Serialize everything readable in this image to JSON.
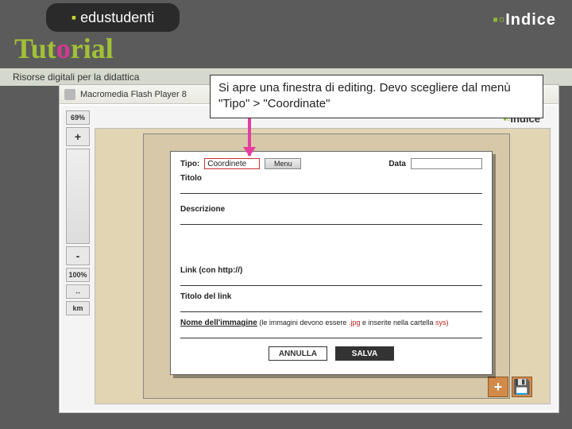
{
  "header": {
    "brand_logo": "edustudenti",
    "indice": "Indice",
    "tutorial": "Tutorial",
    "subtitle": "Risorse digitali per la didattica"
  },
  "window": {
    "title": "Macromedia Flash Player 8"
  },
  "tools": {
    "zoom_readout": "69%",
    "plus": "+",
    "minus": "-",
    "hundred": "100%",
    "fit": "↔",
    "km": "km"
  },
  "callout": {
    "text": "Si apre una finestra di editing. Devo scegliere dal menù \"Tipo\" > \"Coordinate\""
  },
  "edit": {
    "tipo_label": "Tipo:",
    "tipo_value": "Coordinete",
    "menu_label": "Menu",
    "data_label": "Data",
    "titolo_label": "Titolo",
    "descrizione_label": "Descrizione",
    "link_label": "Link (con http://)",
    "titolo_link_label": "Titolo del link",
    "nome_img_label": "Nome dell'immagine",
    "nome_img_note_a": "(le immagini devono essere ",
    "nome_img_jpg": ".jpg",
    "nome_img_note_b": " e inserite nella cartella ",
    "nome_img_sys": "sys)",
    "cancel": "ANNULLA",
    "save": "SALVA"
  },
  "corner": {
    "plus": "+",
    "save": "💾"
  },
  "indice_small": "Indice"
}
